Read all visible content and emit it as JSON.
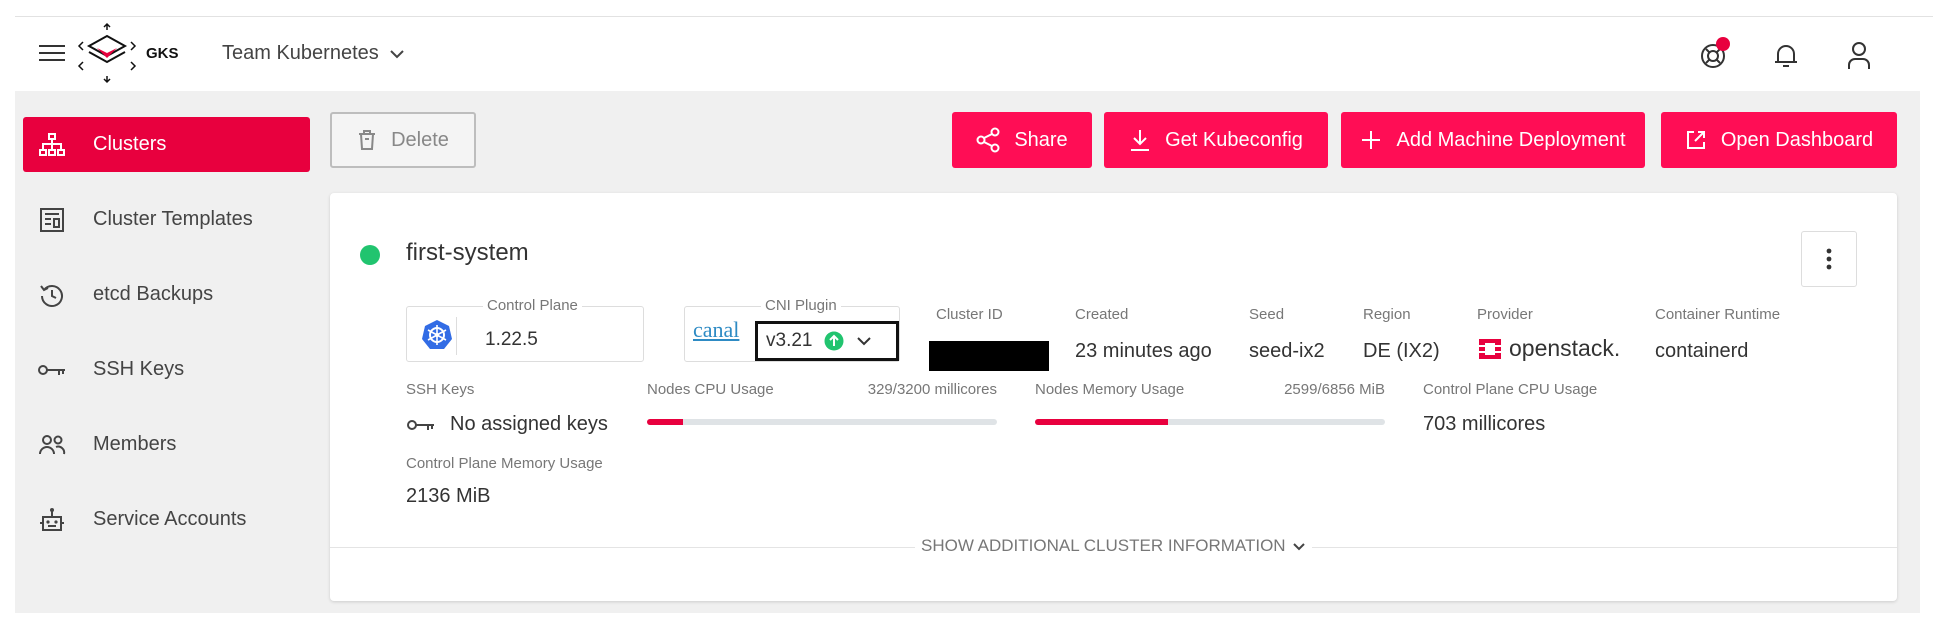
{
  "header": {
    "logo_text": "GKS",
    "project": "Team Kubernetes"
  },
  "sidebar": {
    "items": [
      {
        "label": "Clusters",
        "icon": "sitemap-icon",
        "active": true
      },
      {
        "label": "Cluster Templates",
        "icon": "template-icon",
        "active": false
      },
      {
        "label": "etcd Backups",
        "icon": "history-icon",
        "active": false
      },
      {
        "label": "SSH Keys",
        "icon": "key-icon",
        "active": false
      },
      {
        "label": "Members",
        "icon": "people-icon",
        "active": false
      },
      {
        "label": "Service Accounts",
        "icon": "robot-icon",
        "active": false
      }
    ]
  },
  "toolbar": {
    "delete_label": "Delete",
    "share_label": "Share",
    "kubeconfig_label": "Get Kubeconfig",
    "add_md_label": "Add Machine Deployment",
    "dashboard_label": "Open Dashboard"
  },
  "cluster": {
    "name": "first-system",
    "status_color": "#21c46f",
    "control_plane_label": "Control Plane",
    "control_plane_version": "1.22.5",
    "cni_label": "CNI Plugin",
    "cni_logo_text": "canal",
    "cni_version": "v3.21",
    "cluster_id_label": "Cluster ID",
    "created_label": "Created",
    "created_value": "23 minutes ago",
    "seed_label": "Seed",
    "seed_value": "seed-ix2",
    "region_label": "Region",
    "region_value": "DE (IX2)",
    "provider_label": "Provider",
    "provider_value": "openstack.",
    "runtime_label": "Container Runtime",
    "runtime_value": "containerd",
    "ssh_keys_label": "SSH Keys",
    "ssh_keys_value": "No assigned keys",
    "cpu_label": "Nodes CPU Usage",
    "cpu_value": "329/3200 millicores",
    "cpu_fraction": 0.103,
    "mem_label": "Nodes Memory Usage",
    "mem_value": "2599/6856 MiB",
    "mem_fraction": 0.379,
    "cp_cpu_label": "Control Plane CPU Usage",
    "cp_cpu_value": "703 millicores",
    "cp_mem_label": "Control Plane Memory Usage",
    "cp_mem_value": "2136 MiB",
    "show_more_label": "SHOW ADDITIONAL CLUSTER INFORMATION"
  },
  "colors": {
    "accent": "#ff0d55",
    "active_nav": "#e8003e",
    "status_ok": "#21c46f"
  }
}
